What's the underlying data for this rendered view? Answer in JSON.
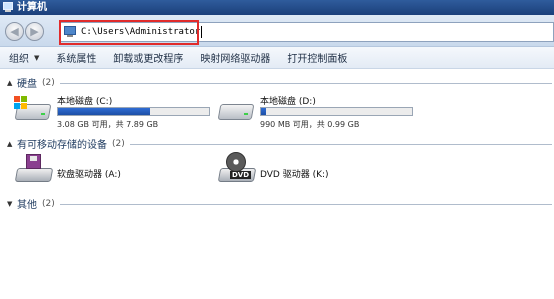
{
  "window": {
    "title": "计算机"
  },
  "address_bar": {
    "path": "C:\\Users\\Administrator"
  },
  "toolbar": {
    "organize": "组织",
    "system_properties": "系统属性",
    "uninstall": "卸载或更改程序",
    "map_drive": "映射网络驱动器",
    "control_panel": "打开控制面板"
  },
  "groups": {
    "hard_disks": {
      "label": "硬盘",
      "count": "(2)"
    },
    "removable": {
      "label": "有可移动存储的设备",
      "count": "(2)"
    },
    "other": {
      "label": "其他",
      "count": "(2)"
    }
  },
  "drives": {
    "c": {
      "name": "本地磁盘 (C:)",
      "space": "3.08 GB 可用，共 7.89 GB",
      "used_fraction": 0.61
    },
    "d": {
      "name": "本地磁盘 (D:)",
      "space": "990 MB 可用，共 0.99 GB",
      "used_fraction": 0.03
    },
    "a": {
      "name": "软盘驱动器 (A:)"
    },
    "k": {
      "name": "DVD 驱动器 (K:)"
    }
  },
  "colors": {
    "highlight_box": "#e12b2b",
    "usage_bar": "#2f6cd4"
  }
}
